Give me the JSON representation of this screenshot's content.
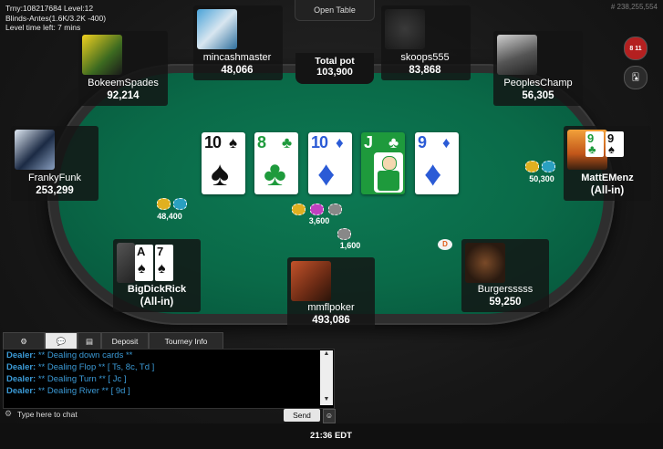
{
  "tournament": {
    "line1": "Trny:108217684 Level:12",
    "line2": "Blinds-Antes(1.6K/3.2K -400)",
    "line3": "Level time left: 7 mins"
  },
  "table_id": "# 238,255,554",
  "open_table_label": "Open Table",
  "pot": {
    "label": "Total pot",
    "value": "103,900"
  },
  "board": [
    {
      "rank": "10",
      "suit": "♠",
      "color": "black"
    },
    {
      "rank": "8",
      "suit": "♣",
      "color": "green"
    },
    {
      "rank": "10",
      "suit": "♦",
      "color": "blue"
    },
    {
      "rank": "J",
      "suit": "♣",
      "color": "green"
    },
    {
      "rank": "9",
      "suit": "♦",
      "color": "blue"
    }
  ],
  "players": {
    "mincashmaster": {
      "name": "mincashmaster",
      "stack": "48,066"
    },
    "skoops": {
      "name": "skoops555",
      "stack": "83,868"
    },
    "bokeem": {
      "name": "BokeemSpades",
      "stack": "92,214"
    },
    "peoples": {
      "name": "PeoplesChamp",
      "stack": "56,305"
    },
    "franky": {
      "name": "FrankyFunk",
      "stack": "253,299"
    },
    "mattemenz": {
      "name": "MattEMenz",
      "stack": "(All-in)",
      "cards": [
        {
          "rank": "9",
          "suit": "♣"
        },
        {
          "rank": "9",
          "suit": "♠"
        }
      ]
    },
    "bigdick": {
      "name": "BigDickRick",
      "stack": "(All-in)",
      "cards": [
        {
          "rank": "A",
          "suit": "♠"
        },
        {
          "rank": "7",
          "suit": "♠"
        }
      ]
    },
    "burgers": {
      "name": "Burgersssss",
      "stack": "59,250"
    },
    "mmfl": {
      "name": "mmflpoker",
      "stack": "493,086"
    }
  },
  "bets": {
    "franky": "48,400",
    "mattemenz": "50,300",
    "center": "3,600",
    "bottom": "1,600"
  },
  "dealer_button": "D",
  "chat_tabs": {
    "deposit": "Deposit",
    "tourney_info": "Tourney Info"
  },
  "chat_lines": [
    {
      "who": "Dealer:",
      "text": "** Dealing down cards **"
    },
    {
      "who": "Dealer:",
      "text": "** Dealing Flop ** [ Ts, 8c, Td ]"
    },
    {
      "who": "Dealer:",
      "text": "** Dealing Turn ** [ Jc ]"
    },
    {
      "who": "Dealer:",
      "text": "** Dealing River ** [ 9d ]"
    }
  ],
  "chat_input": {
    "placeholder": "Type here to chat",
    "send": "Send"
  },
  "clock": "21:36 EDT",
  "tools": {
    "hand_count": "8 11"
  }
}
